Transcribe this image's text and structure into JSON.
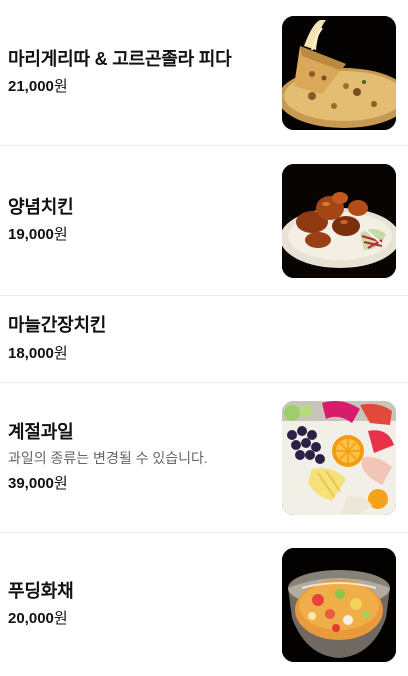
{
  "currency_unit": "원",
  "items": [
    {
      "name": "마리게리따 & 고르곤졸라 피다",
      "price": "21,000",
      "description": "",
      "image": "pizza-photo"
    },
    {
      "name": "양념치킨",
      "price": "19,000",
      "description": "",
      "image": "chicken-photo"
    },
    {
      "name": "마늘간장치킨",
      "price": "18,000",
      "description": "",
      "image": ""
    },
    {
      "name": "계절과일",
      "price": "39,000",
      "description": "과일의 종류는 변경될 수 있습니다.",
      "image": "fruit-platter-photo"
    },
    {
      "name": "푸딩화채",
      "price": "20,000",
      "description": "",
      "image": "punch-bowl-photo"
    }
  ]
}
